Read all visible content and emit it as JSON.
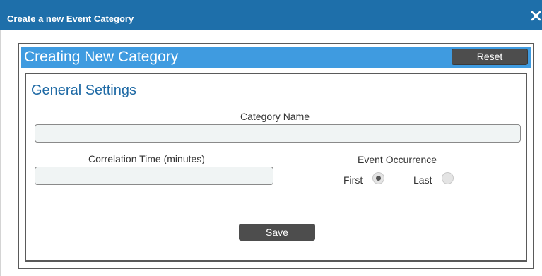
{
  "window": {
    "title": "Create a new Event Category",
    "close_icon": "close-icon"
  },
  "panel": {
    "title": "Creating New Category",
    "reset_label": "Reset"
  },
  "general_settings": {
    "title": "General Settings",
    "category_name_label": "Category Name",
    "category_name_value": "",
    "correlation_time_label": "Correlation Time (minutes)",
    "correlation_time_value": "",
    "event_occurrence_label": "Event Occurrence",
    "occurrence_options": [
      {
        "label": "First",
        "selected": true
      },
      {
        "label": "Last",
        "selected": false
      }
    ],
    "save_label": "Save"
  },
  "colors": {
    "titlebar": "#1e6faa",
    "panel_header": "#3f9be0",
    "section_title": "#1f6aa5",
    "button": "#4d4d4d"
  }
}
